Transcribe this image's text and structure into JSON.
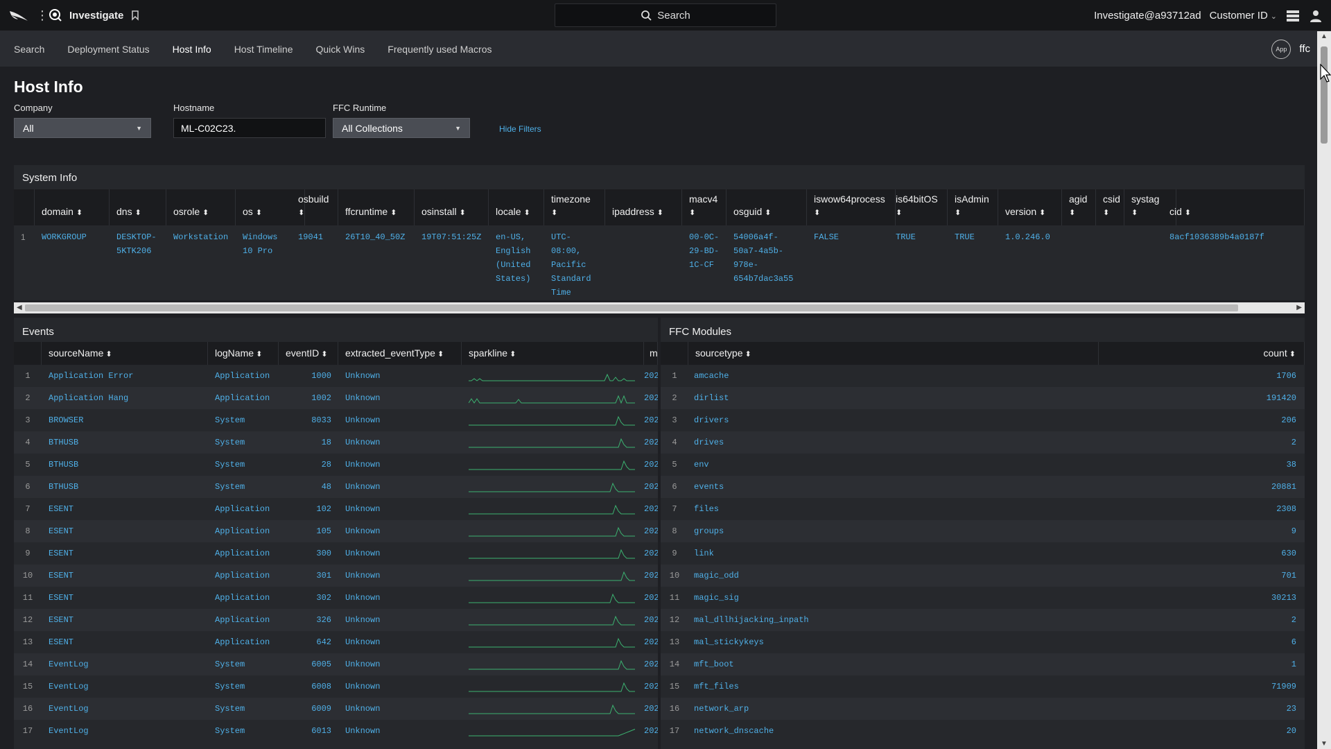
{
  "topbar": {
    "app_name": "Investigate",
    "search_label": "Search",
    "user": "Investigate@a93712ad",
    "customer_label": "Customer ID"
  },
  "nav": {
    "items": [
      "Search",
      "Deployment Status",
      "Host Info",
      "Host Timeline",
      "Quick Wins",
      "Frequently used Macros"
    ],
    "active": "Host Info",
    "app_badge": "App",
    "app_name": "ffc"
  },
  "page": {
    "title": "Host Info",
    "hide_filters": "Hide Filters"
  },
  "filters": {
    "company": {
      "label": "Company",
      "value": "All"
    },
    "hostname": {
      "label": "Hostname",
      "value": "ML-C02C23."
    },
    "runtime": {
      "label": "FFC Runtime",
      "value": "All Collections"
    }
  },
  "system_info": {
    "title": "System Info",
    "columns": [
      "domain",
      "dns",
      "osrole",
      "os",
      "osbuild",
      "ffcruntime",
      "osinstall",
      "locale",
      "timezone",
      "ipaddress",
      "macv4",
      "osguid",
      "iswow64process",
      "is64bitOS",
      "isAdmin",
      "version",
      "agid",
      "csid",
      "systag",
      "cid"
    ],
    "row": {
      "num": "1",
      "domain": "WORKGROUP",
      "dns": "DESKTOP-\n5KTK206",
      "osrole": "Workstation",
      "os": "Windows\n10 Pro",
      "osbuild": "19041",
      "ffcruntime": "26T10_40_50Z",
      "osinstall": "19T07:51:25Z",
      "locale": "en-US,\nEnglish\n(United\nStates)",
      "timezone": "UTC-\n08:00,\nPacific\nStandard\nTime",
      "ipaddress": "",
      "macv4": "00-0C-\n29-BD-\n1C-CF",
      "osguid": "54006a4f-\n50a7-4a5b-\n978e-\n654b7dac3a55",
      "iswow64process": "FALSE",
      "is64bitOS": "TRUE",
      "isAdmin": "TRUE",
      "version": "1.0.246.0",
      "agid": "",
      "csid": "",
      "systag": "",
      "cid": "8acf1036389b4a0187f"
    }
  },
  "events": {
    "title": "Events",
    "columns": [
      "sourceName",
      "logName",
      "eventID",
      "extracted_eventType",
      "sparkline",
      "mir"
    ],
    "rows": [
      {
        "n": "1",
        "sourceName": "Application Error",
        "logName": "Application",
        "eventID": "1000",
        "type": "Unknown",
        "first": "202"
      },
      {
        "n": "2",
        "sourceName": "Application Hang",
        "logName": "Application",
        "eventID": "1002",
        "type": "Unknown",
        "first": "202"
      },
      {
        "n": "3",
        "sourceName": "BROWSER",
        "logName": "System",
        "eventID": "8033",
        "type": "Unknown",
        "first": "202"
      },
      {
        "n": "4",
        "sourceName": "BTHUSB",
        "logName": "System",
        "eventID": "18",
        "type": "Unknown",
        "first": "202"
      },
      {
        "n": "5",
        "sourceName": "BTHUSB",
        "logName": "System",
        "eventID": "28",
        "type": "Unknown",
        "first": "202"
      },
      {
        "n": "6",
        "sourceName": "BTHUSB",
        "logName": "System",
        "eventID": "48",
        "type": "Unknown",
        "first": "202"
      },
      {
        "n": "7",
        "sourceName": "ESENT",
        "logName": "Application",
        "eventID": "102",
        "type": "Unknown",
        "first": "202"
      },
      {
        "n": "8",
        "sourceName": "ESENT",
        "logName": "Application",
        "eventID": "105",
        "type": "Unknown",
        "first": "202"
      },
      {
        "n": "9",
        "sourceName": "ESENT",
        "logName": "Application",
        "eventID": "300",
        "type": "Unknown",
        "first": "202"
      },
      {
        "n": "10",
        "sourceName": "ESENT",
        "logName": "Application",
        "eventID": "301",
        "type": "Unknown",
        "first": "202"
      },
      {
        "n": "11",
        "sourceName": "ESENT",
        "logName": "Application",
        "eventID": "302",
        "type": "Unknown",
        "first": "202"
      },
      {
        "n": "12",
        "sourceName": "ESENT",
        "logName": "Application",
        "eventID": "326",
        "type": "Unknown",
        "first": "202"
      },
      {
        "n": "13",
        "sourceName": "ESENT",
        "logName": "Application",
        "eventID": "642",
        "type": "Unknown",
        "first": "202"
      },
      {
        "n": "14",
        "sourceName": "EventLog",
        "logName": "System",
        "eventID": "6005",
        "type": "Unknown",
        "first": "202"
      },
      {
        "n": "15",
        "sourceName": "EventLog",
        "logName": "System",
        "eventID": "6008",
        "type": "Unknown",
        "first": "202"
      },
      {
        "n": "16",
        "sourceName": "EventLog",
        "logName": "System",
        "eventID": "6009",
        "type": "Unknown",
        "first": "202"
      },
      {
        "n": "17",
        "sourceName": "EventLog",
        "logName": "System",
        "eventID": "6013",
        "type": "Unknown",
        "first": "202"
      }
    ]
  },
  "modules": {
    "title": "FFC Modules",
    "columns": [
      "sourcetype",
      "count"
    ],
    "rows": [
      {
        "n": "1",
        "sourcetype": "amcache",
        "count": "1706"
      },
      {
        "n": "2",
        "sourcetype": "dirlist",
        "count": "191420"
      },
      {
        "n": "3",
        "sourcetype": "drivers",
        "count": "206"
      },
      {
        "n": "4",
        "sourcetype": "drives",
        "count": "2"
      },
      {
        "n": "5",
        "sourcetype": "env",
        "count": "38"
      },
      {
        "n": "6",
        "sourcetype": "events",
        "count": "20881"
      },
      {
        "n": "7",
        "sourcetype": "files",
        "count": "2308"
      },
      {
        "n": "8",
        "sourcetype": "groups",
        "count": "9"
      },
      {
        "n": "9",
        "sourcetype": "link",
        "count": "630"
      },
      {
        "n": "10",
        "sourcetype": "magic_odd",
        "count": "701"
      },
      {
        "n": "11",
        "sourcetype": "magic_sig",
        "count": "30213"
      },
      {
        "n": "12",
        "sourcetype": "mal_dllhijacking_inpath",
        "count": "2"
      },
      {
        "n": "13",
        "sourcetype": "mal_stickykeys",
        "count": "6"
      },
      {
        "n": "14",
        "sourcetype": "mft_boot",
        "count": "1"
      },
      {
        "n": "15",
        "sourcetype": "mft_files",
        "count": "71909"
      },
      {
        "n": "16",
        "sourcetype": "network_arp",
        "count": "23"
      },
      {
        "n": "17",
        "sourcetype": "network_dnscache",
        "count": "20"
      }
    ]
  },
  "colors": {
    "link": "#4fb0e8",
    "sparkline": "#3cb371",
    "background": "#1e1f23"
  }
}
